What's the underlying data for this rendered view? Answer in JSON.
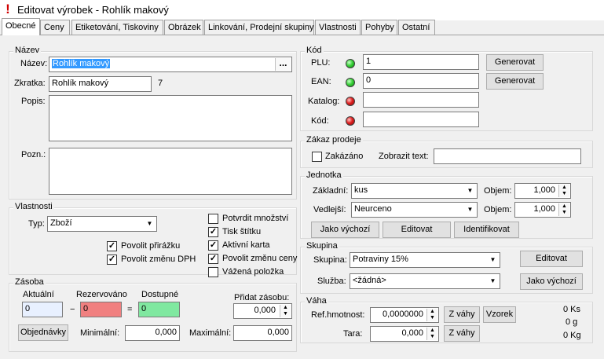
{
  "window": {
    "title": "Editovat výrobek - Rohlík makový"
  },
  "tabs": [
    {
      "label": "Obecné",
      "active": true
    },
    {
      "label": "Ceny"
    },
    {
      "label": "Etiketování, Tiskoviny"
    },
    {
      "label": "Obrázek"
    },
    {
      "label": "Linkování, Prodejní skupiny"
    },
    {
      "label": "Vlastnosti"
    },
    {
      "label": "Pohyby"
    },
    {
      "label": "Ostatní"
    }
  ],
  "nazev": {
    "group": "Název",
    "name_label": "Název:",
    "name_value": "Rohlík makový",
    "ellipsis": "...",
    "short_label": "Zkratka:",
    "short_value": "Rohlík makový",
    "short_len": "7",
    "popis_label": "Popis:",
    "popis_value": "",
    "pozn_label": "Pozn.:",
    "pozn_value": ""
  },
  "vlastnosti": {
    "group": "Vlastnosti",
    "typ_label": "Typ:",
    "typ_value": "Zboží",
    "checks": [
      {
        "label": "Potvrdit množství",
        "checked": false
      },
      {
        "label": "Tisk štítku",
        "checked": true
      },
      {
        "label": "Aktivní karta",
        "checked": true
      },
      {
        "label": "Povolit změnu ceny",
        "checked": true
      },
      {
        "label": "Vážená položka",
        "checked": false
      }
    ],
    "left_checks": [
      {
        "label": "Povolit přirážku",
        "checked": true
      },
      {
        "label": "Povolit změnu DPH",
        "checked": true
      }
    ]
  },
  "zasoba": {
    "group": "Zásoba",
    "aktualni_label": "Aktuální",
    "aktualni_value": "0",
    "rezervovano_label": "Rezervováno",
    "rezervovano_value": "0",
    "dostupne_label": "Dostupné",
    "dostupne_value": "0",
    "minus": "−",
    "equals": "=",
    "pridat_label": "Přidat zásobu:",
    "pridat_value": "0,000",
    "objednavky": "Objednávky",
    "min_label": "Minimální:",
    "min_value": "0,000",
    "max_label": "Maximální:",
    "max_value": "0,000"
  },
  "kod": {
    "group": "Kód",
    "rows": [
      {
        "label": "PLU:",
        "value": "1",
        "led": "green",
        "button": "Generovat"
      },
      {
        "label": "EAN:",
        "value": "0",
        "led": "green",
        "button": "Generovat"
      },
      {
        "label": "Katalog:",
        "value": "",
        "led": "red"
      },
      {
        "label": "Kód:",
        "value": "",
        "led": "red"
      }
    ]
  },
  "zakaz": {
    "group": "Zákaz prodeje",
    "zakazano_label": "Zakázáno",
    "zobrazit_label": "Zobrazit text:",
    "zobrazit_value": ""
  },
  "jednotka": {
    "group": "Jednotka",
    "zakladni_label": "Základní:",
    "zakladni_value": "kus",
    "vedlejsi_label": "Vedlejší:",
    "vedlejsi_value": "Neurceno",
    "objem_label": "Objem:",
    "objem1": "1,000",
    "objem2": "1,000",
    "btn_jako": "Jako výchozí",
    "btn_editovat": "Editovat",
    "btn_identifikovat": "Identifikovat"
  },
  "skupina": {
    "group": "Skupina",
    "skupina_label": "Skupina:",
    "skupina_value": "Potraviny 15%",
    "sluzba_label": "Služba:",
    "sluzba_value": "<žádná>",
    "btn_editovat": "Editovat",
    "btn_jako": "Jako výchozí"
  },
  "vaha": {
    "group": "Váha",
    "ref_label": "Ref.hmotnost:",
    "ref_value": "0,0000000",
    "tara_label": "Tara:",
    "tara_value": "0,000",
    "btn_zvahy1": "Z váhy",
    "btn_zvahy2": "Z váhy",
    "btn_vzorek": "Vzorek",
    "r1": "0 Ks",
    "r2": "0 g",
    "r3": "0 Kg"
  },
  "colors": {
    "reserved_bg": "#f08080",
    "available_bg": "#80e8a0",
    "actual_bg": "#e8f0ff",
    "selection": "#3399ff"
  }
}
